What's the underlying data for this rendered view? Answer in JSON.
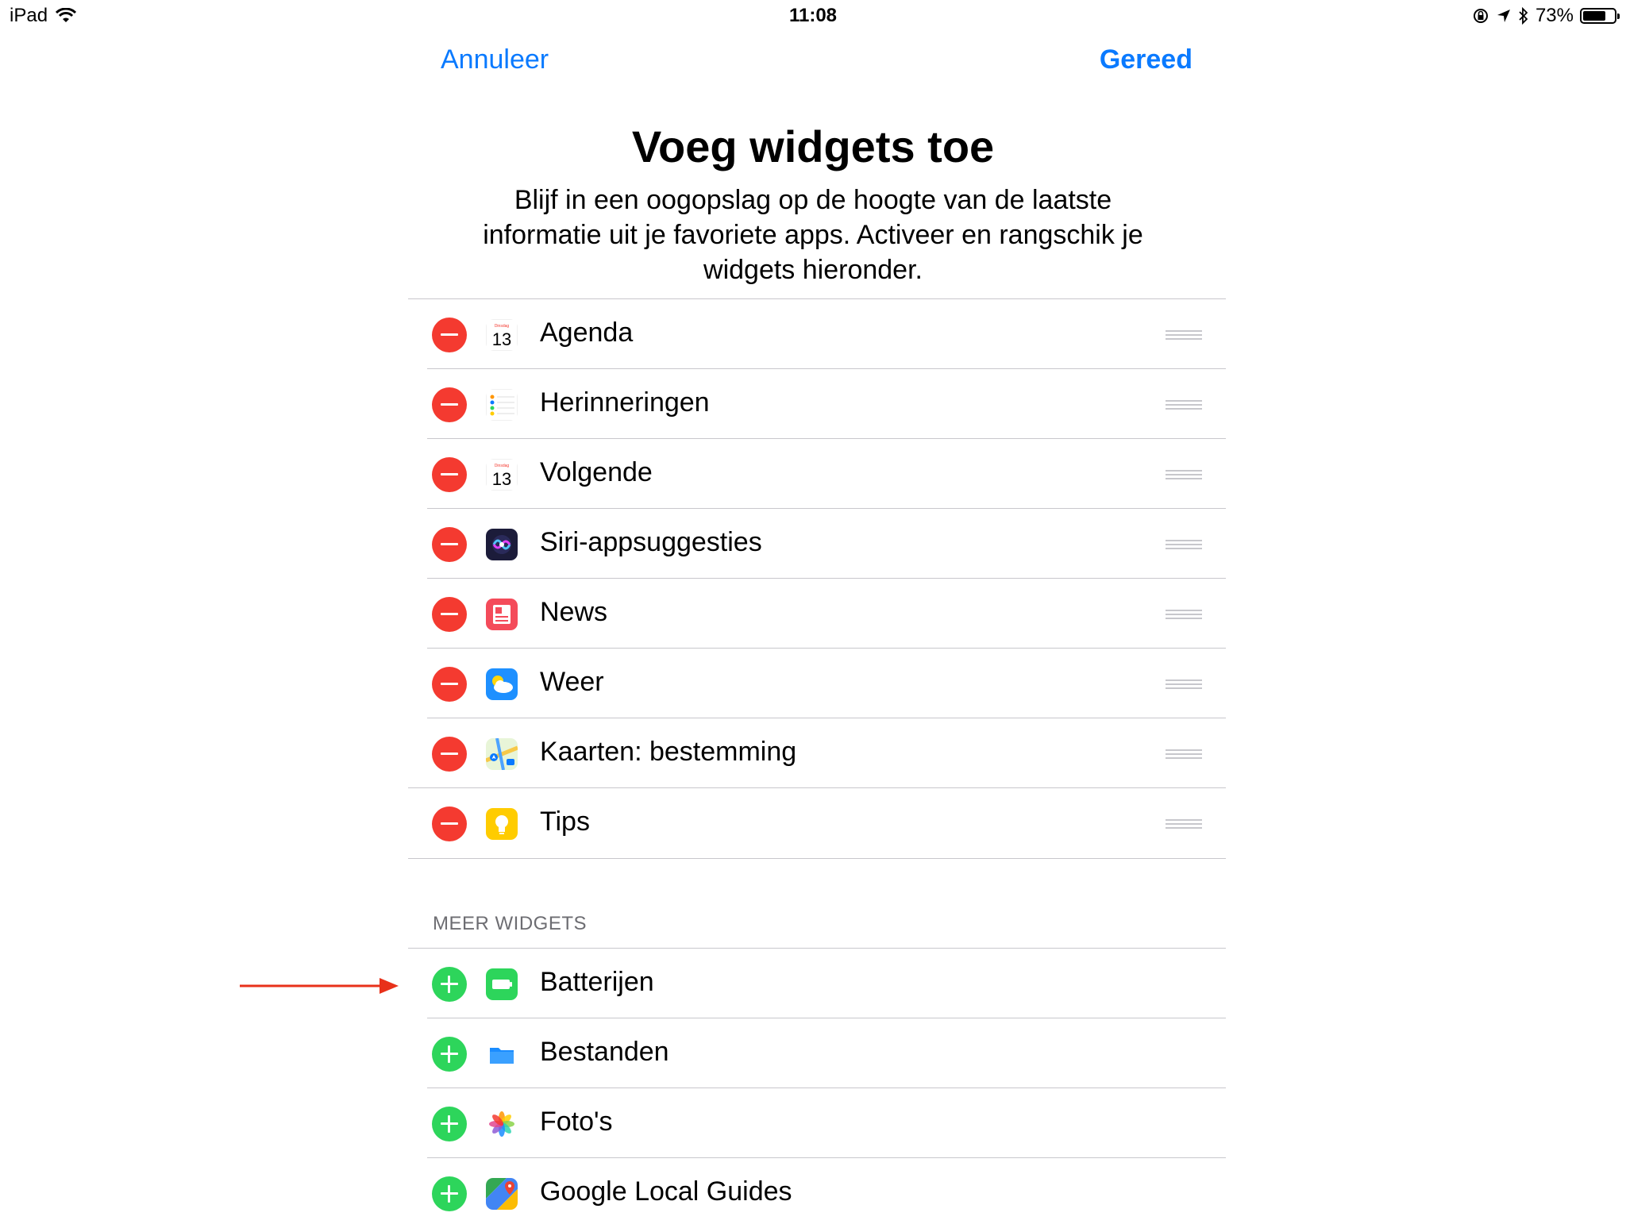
{
  "status_bar": {
    "device": "iPad",
    "time": "11:08",
    "battery_percent": "73%",
    "battery_level": 0.73
  },
  "nav": {
    "cancel_label": "Annuleer",
    "done_label": "Gereed"
  },
  "header": {
    "title": "Voeg widgets toe",
    "description": "Blijf in een oogopslag op de hoogte van de laatste informatie uit je favoriete apps. Activeer en rangschik je widgets hieronder."
  },
  "active_widgets": [
    {
      "label": "Agenda",
      "icon": "calendar-icon",
      "day_label": "Dinsdag",
      "date": "13"
    },
    {
      "label": "Herinneringen",
      "icon": "reminders-icon"
    },
    {
      "label": "Volgende",
      "icon": "calendar-icon",
      "day_label": "Dinsdag",
      "date": "13"
    },
    {
      "label": "Siri-appsuggesties",
      "icon": "siri-icon"
    },
    {
      "label": "News",
      "icon": "news-icon"
    },
    {
      "label": "Weer",
      "icon": "weather-icon"
    },
    {
      "label": "Kaarten: bestemming",
      "icon": "maps-icon"
    },
    {
      "label": "Tips",
      "icon": "tips-icon"
    }
  ],
  "more_widgets": {
    "header": "MEER WIDGETS",
    "items": [
      {
        "label": "Batterijen",
        "icon": "battery-widget-icon"
      },
      {
        "label": "Bestanden",
        "icon": "files-icon"
      },
      {
        "label": "Foto's",
        "icon": "photos-icon"
      },
      {
        "label": "Google Local Guides",
        "icon": "google-maps-icon"
      }
    ]
  },
  "colors": {
    "accent": "#0a7aff",
    "remove": "#f43a30",
    "add": "#2dd55b",
    "annotation_arrow": "#e8311a"
  },
  "annotation": {
    "icon": "red-arrow-annotation"
  }
}
